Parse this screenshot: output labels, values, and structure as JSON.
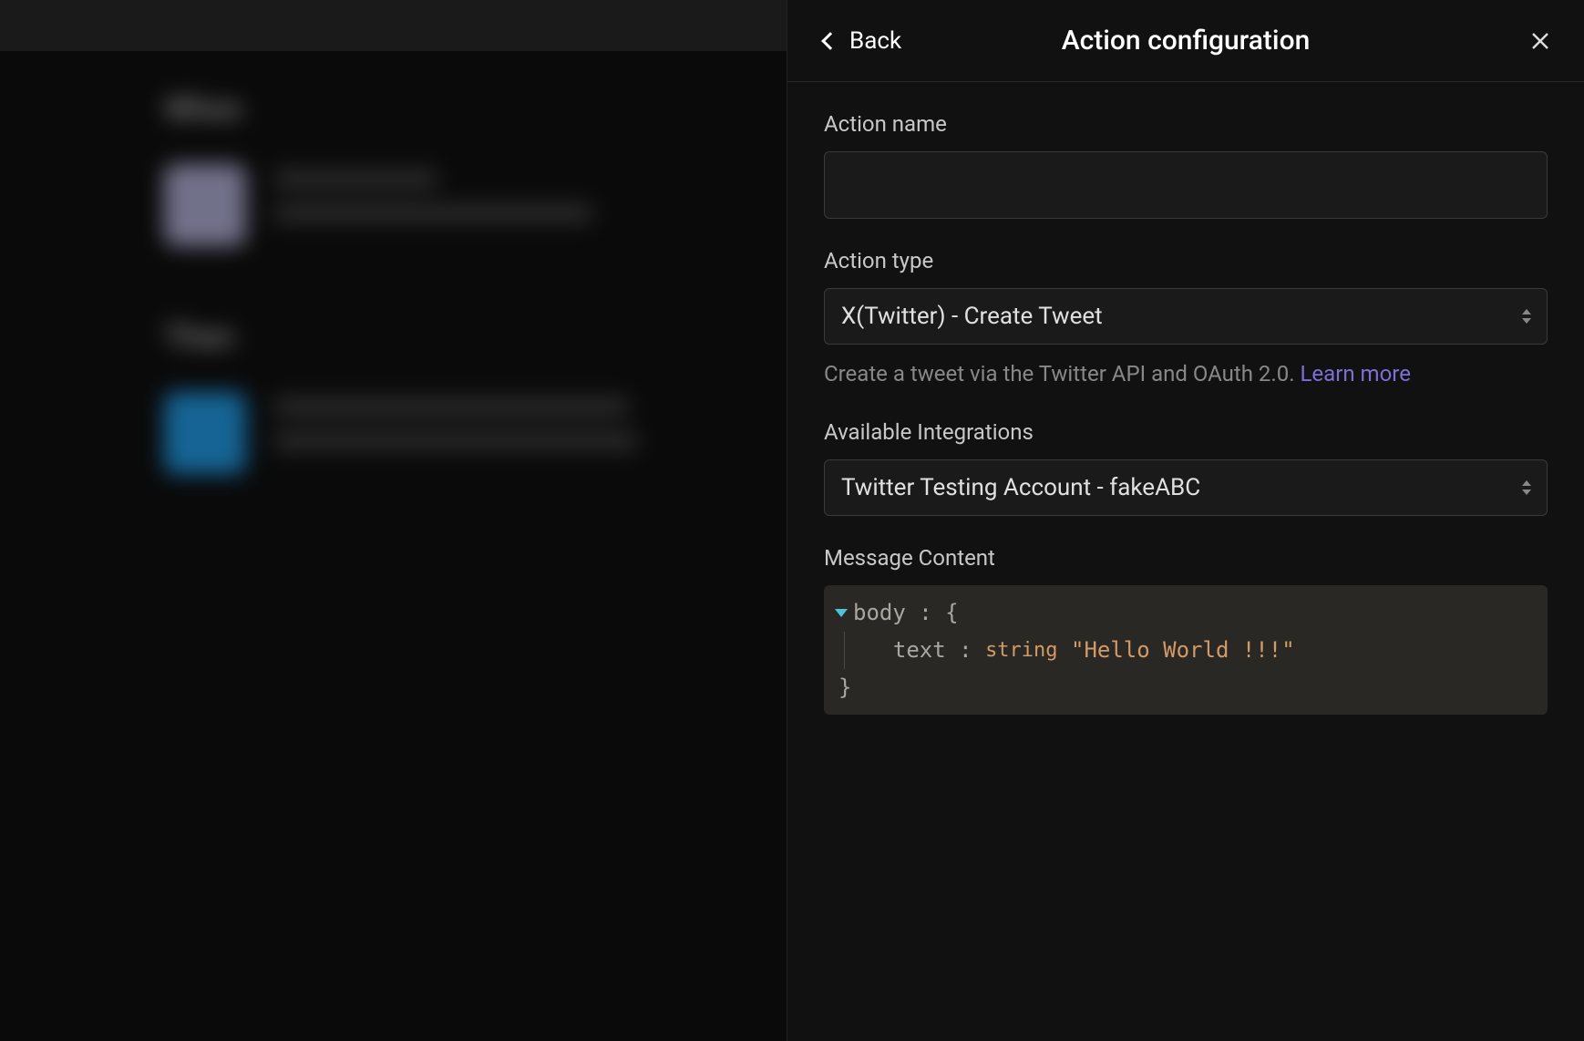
{
  "panel": {
    "back_label": "Back",
    "title": "Action configuration"
  },
  "fields": {
    "action_name": {
      "label": "Action name",
      "value": ""
    },
    "action_type": {
      "label": "Action type",
      "selected": "X(Twitter) - Create Tweet",
      "hint": "Create a tweet via the Twitter API and OAuth 2.0. ",
      "learn_more": "Learn more"
    },
    "integrations": {
      "label": "Available Integrations",
      "selected": "Twitter Testing Account - fakeABC"
    },
    "message_content": {
      "label": "Message Content",
      "body_key": "body",
      "text_key": "text",
      "text_type": "string",
      "text_value": "\"Hello World !!!\""
    }
  },
  "bg": {
    "section1": "When",
    "section2": "Then"
  }
}
